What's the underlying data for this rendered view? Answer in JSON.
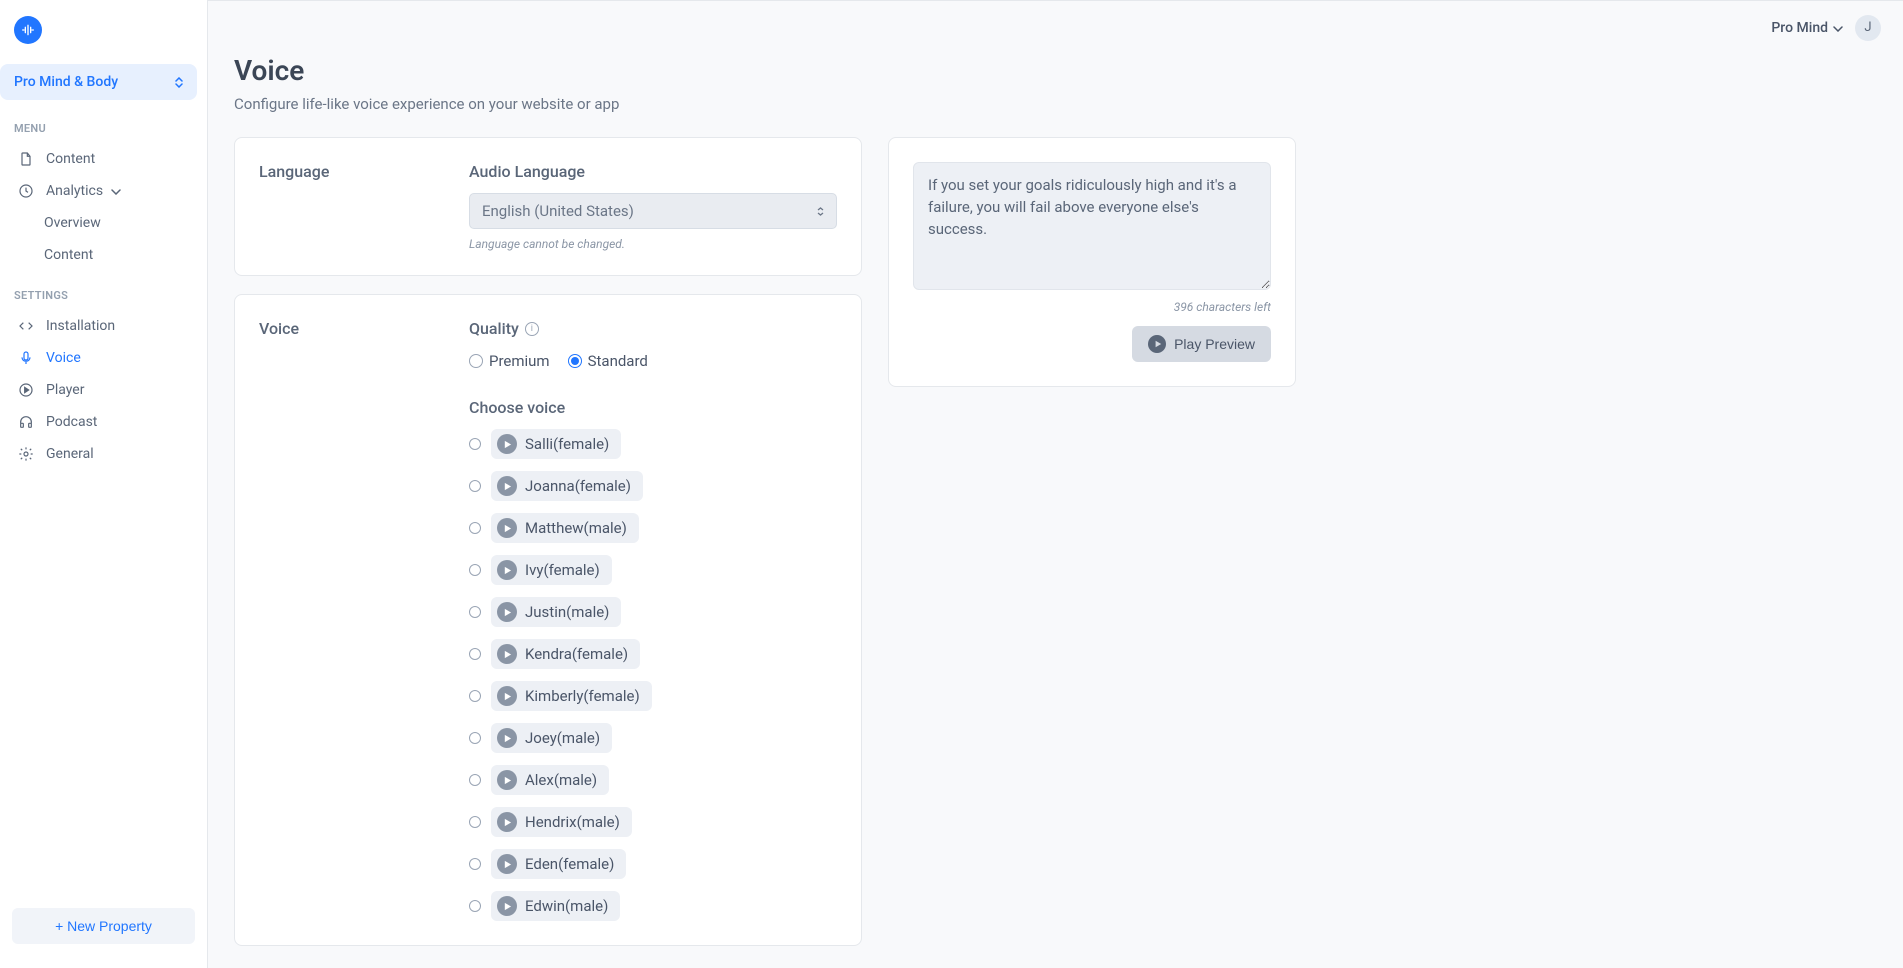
{
  "sidebar": {
    "property": "Pro Mind & Body",
    "menu_label": "MENU",
    "settings_label": "SETTINGS",
    "items_menu": [
      {
        "label": "Content",
        "icon": "file"
      },
      {
        "label": "Analytics",
        "icon": "clock",
        "expandable": true
      }
    ],
    "analytics_sub": [
      {
        "label": "Overview"
      },
      {
        "label": "Content"
      }
    ],
    "items_settings": [
      {
        "label": "Installation",
        "icon": "code"
      },
      {
        "label": "Voice",
        "icon": "mic",
        "active": true
      },
      {
        "label": "Player",
        "icon": "play-c"
      },
      {
        "label": "Podcast",
        "icon": "headphones"
      },
      {
        "label": "General",
        "icon": "gear"
      }
    ],
    "new_property": "+ New Property"
  },
  "topbar": {
    "workspace": "Pro Mind",
    "avatar_initial": "J"
  },
  "page": {
    "title": "Voice",
    "description": "Configure life-like voice experience on your website or app"
  },
  "language_card": {
    "section_label": "Language",
    "field_label": "Audio Language",
    "value": "English (United States)",
    "helper": "Language cannot be changed."
  },
  "voice_card": {
    "section_label": "Voice",
    "quality_label": "Quality",
    "quality_options": [
      {
        "label": "Premium",
        "checked": false
      },
      {
        "label": "Standard",
        "checked": true
      }
    ],
    "choose_label": "Choose voice",
    "voices": [
      {
        "name": "Salli",
        "gender": "female"
      },
      {
        "name": "Joanna",
        "gender": "female"
      },
      {
        "name": "Matthew",
        "gender": "male"
      },
      {
        "name": "Ivy",
        "gender": "female"
      },
      {
        "name": "Justin",
        "gender": "male"
      },
      {
        "name": "Kendra",
        "gender": "female"
      },
      {
        "name": "Kimberly",
        "gender": "female"
      },
      {
        "name": "Joey",
        "gender": "male"
      },
      {
        "name": "Alex",
        "gender": "male"
      },
      {
        "name": "Hendrix",
        "gender": "male"
      },
      {
        "name": "Eden",
        "gender": "female"
      },
      {
        "name": "Edwin",
        "gender": "male"
      }
    ]
  },
  "preview": {
    "text": "If you set your goals ridiculously high and it's a failure, you will fail above everyone else's success.",
    "chars_left": "396 characters left",
    "button": "Play Preview"
  }
}
